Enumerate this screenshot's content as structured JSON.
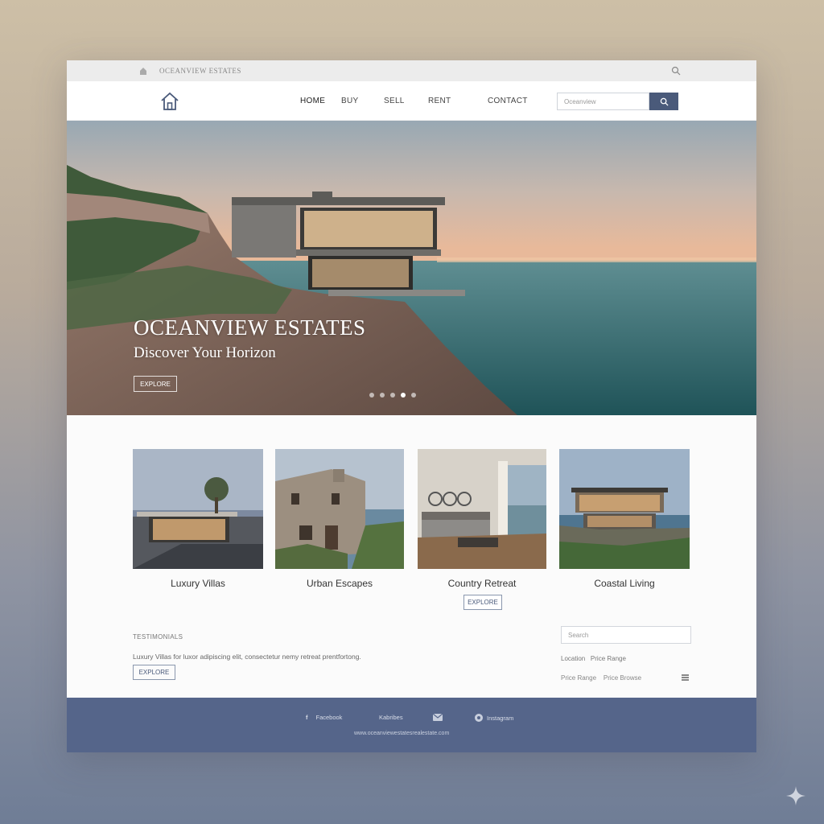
{
  "topbar": {
    "brand": "OCEANVIEW ESTATES"
  },
  "nav": {
    "links": [
      "HOME",
      "BUY",
      "SELL",
      "RENT",
      "CONTACT"
    ],
    "search_placeholder": "Oceanview"
  },
  "hero": {
    "title": "OCEANVIEW ESTATES",
    "subtitle": "Discover Your Horizon",
    "cta": "EXPLORE",
    "slides": 5,
    "active_slide": 3
  },
  "cards": [
    {
      "label": "Luxury Villas"
    },
    {
      "label": "Urban Escapes"
    },
    {
      "label": "Country Retreat"
    },
    {
      "label": "Coastal Living"
    }
  ],
  "cards_cta": "EXPLORE",
  "testimonials": {
    "label": "TESTIMONIALS",
    "text": "Luxury Villas for luxor adipiscing elit, consectetur nemy retreat prentfortong.",
    "cta": "EXPLORE"
  },
  "sidebar": {
    "search_placeholder": "Search",
    "filter_row1": "Location   Price Range",
    "filter_row2": "Price Range    Price Browse"
  },
  "footer": {
    "social": [
      "Facebook",
      "Kabribes",
      "Instagram"
    ],
    "url": "www.oceanviewestatesrealestate.com"
  },
  "colors": {
    "accent": "#4a5a7a",
    "footer": "#55658a"
  }
}
